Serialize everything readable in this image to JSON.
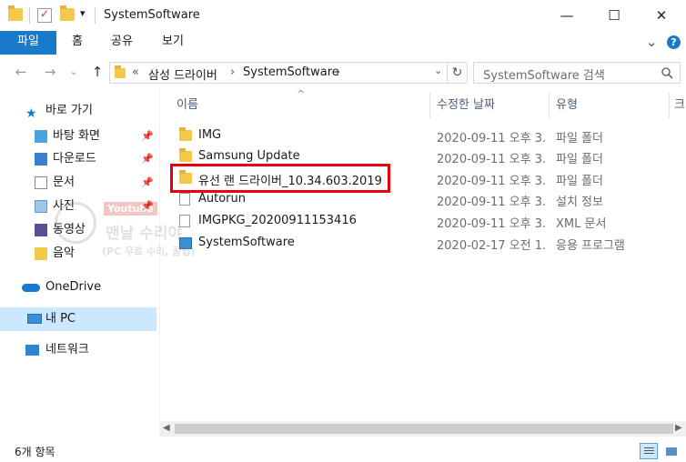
{
  "titlebar": {
    "title": "SystemSoftware",
    "minimize": "—",
    "maximize": "☐",
    "close": "✕",
    "dropdown": "▾"
  },
  "ribbon": {
    "tabs": [
      "파일",
      "홈",
      "공유",
      "보기"
    ],
    "expand": "⌄",
    "help": "?"
  },
  "address": {
    "back": "←",
    "forward": "→",
    "history": "⌄",
    "up": "↑",
    "overflow": "«",
    "crumbs": [
      "삼성 드라이버",
      "SystemSoftware"
    ],
    "chevron": "›",
    "refresh": "↻",
    "search_placeholder": "SystemSoftware 검색",
    "search_icon": "search-icon"
  },
  "nav": {
    "quick_access": "바로 가기",
    "quick_items": [
      {
        "label": "바탕 화면",
        "pinned": true
      },
      {
        "label": "다운로드",
        "pinned": true
      },
      {
        "label": "문서",
        "pinned": true
      },
      {
        "label": "사진",
        "pinned": true
      },
      {
        "label": "동영상",
        "pinned": false
      },
      {
        "label": "음악",
        "pinned": false
      }
    ],
    "onedrive": "OneDrive",
    "thispc": "내 PC",
    "network": "네트워크",
    "pin_glyph": "📌"
  },
  "columns": {
    "name": "이름",
    "date": "수정한 날짜",
    "type": "유형",
    "size": "크",
    "sort_indicator": "^"
  },
  "files": [
    {
      "name": "IMG",
      "date": "2020-09-11 오후 3...",
      "type": "파일 폴더",
      "icon": "folder-icon"
    },
    {
      "name": "Samsung Update",
      "date": "2020-09-11 오후 3...",
      "type": "파일 폴더",
      "icon": "folder-icon"
    },
    {
      "name": "유선 랜 드라이버_10.34.603.2019",
      "date": "2020-09-11 오후 3...",
      "type": "파일 폴더",
      "icon": "folder-icon"
    },
    {
      "name": "Autorun",
      "date": "2020-09-11 오후 3...",
      "type": "설치 정보",
      "icon": "settings-file-icon"
    },
    {
      "name": "IMGPKG_20200911153416",
      "date": "2020-09-11 오후 3...",
      "type": "XML 문서",
      "icon": "xml-file-icon"
    },
    {
      "name": "SystemSoftware",
      "date": "2020-02-17 오전 1...",
      "type": "응용 프로그램",
      "icon": "app-icon"
    }
  ],
  "status": {
    "count": "6개 항목"
  },
  "watermark": {
    "youtube": "Youtube",
    "name": "맨날 수리야",
    "sub": "(PC 무료 수리, 꿀팁)"
  },
  "colors": {
    "accent": "#1979ca",
    "selected": "#cce8ff",
    "highlight_box": "#e8000b",
    "folder": "#f3c94b"
  }
}
